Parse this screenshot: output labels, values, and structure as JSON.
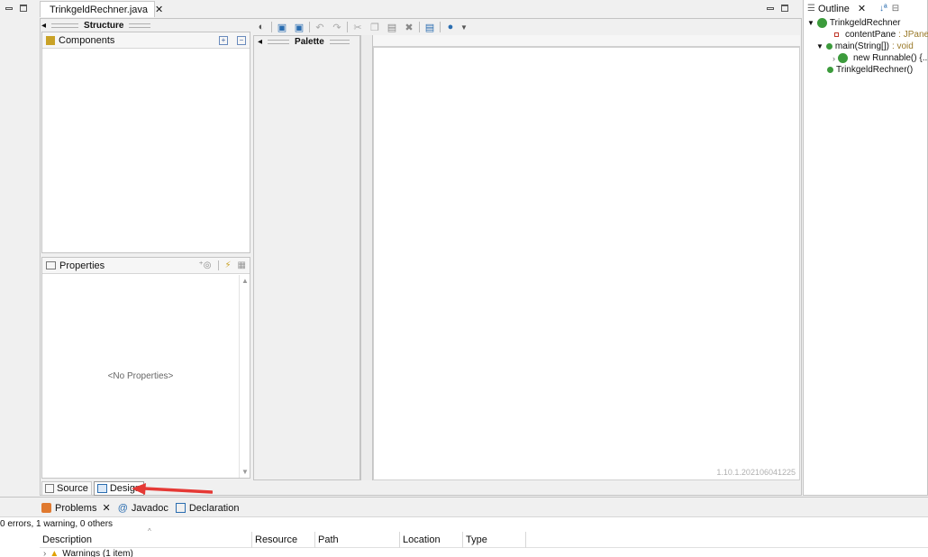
{
  "editor": {
    "tab_title": "TrinkgeldRechner.java",
    "structure_title": "Structure",
    "components_label": "Components",
    "palette_title": "Palette",
    "properties_label": "Properties",
    "no_properties": "<No Properties>",
    "version": "1.10.1.202106041225",
    "bottom_tabs": {
      "source": "Source",
      "design": "Design"
    }
  },
  "outline": {
    "tab_title": "Outline",
    "items": [
      {
        "label": "TrinkgeldRechner",
        "type": ""
      },
      {
        "label": "contentPane",
        "type": " : JPanel"
      },
      {
        "label": "main(String[])",
        "type": " : void"
      },
      {
        "label": "new Runnable() {...",
        "type": ""
      },
      {
        "label": "TrinkgeldRechner()",
        "type": ""
      }
    ]
  },
  "problems": {
    "tabs": {
      "problems": "Problems",
      "javadoc": "Javadoc",
      "declaration": "Declaration"
    },
    "summary": "0 errors, 1 warning, 0 others",
    "columns": [
      "Description",
      "Resource",
      "Path",
      "Location",
      "Type"
    ],
    "rows": [
      {
        "description": "Warnings (1 item)"
      }
    ]
  },
  "colors": {
    "accent_red": "#e53935",
    "selection_blue": "#1f5fbf"
  }
}
